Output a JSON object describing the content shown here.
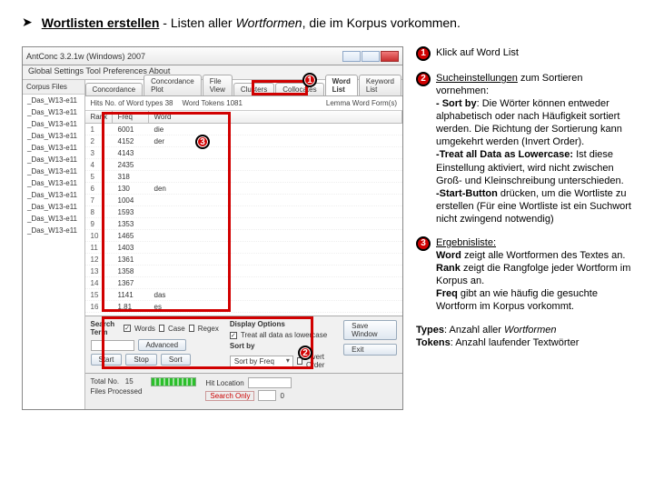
{
  "heading": {
    "bold": "Wortlisten erstellen",
    "rest_a": " - Listen aller ",
    "ital": "Wortformen",
    "rest_b": ", die im Korpus vorkommen."
  },
  "app": {
    "title": "AntConc 3.2.1w (Windows) 2007",
    "menu": "Global Settings  Tool Preferences  About",
    "sidebar_hd": "Corpus Files",
    "sidebar_items": [
      "_Das_W13-e11",
      "_Das_W13-e11",
      "_Das_W13-e11",
      "_Das_W13-e11",
      "_Das_W13-e11",
      "_Das_W13-e11",
      "_Das_W13-e11",
      "_Das_W13-e11",
      "_Das_W13-e11",
      "_Das_W13-e11",
      "_Das_W13-e11",
      "_Das_W13-e11"
    ],
    "tabs": [
      "Concordance",
      "Concordance Plot",
      "File View",
      "Clusters",
      "Collocates",
      "Word List",
      "Keyword List"
    ],
    "active_tab_index": 5,
    "sub_toolbar_a": "Hits No. of Word types 38",
    "sub_toolbar_b": "Word Tokens 1081",
    "sub_toolbar_c": "Lemma Word Form(s)",
    "table": {
      "head": [
        "Rank",
        "Freq",
        "Word"
      ],
      "rows": [
        [
          "1",
          "6001",
          "die"
        ],
        [
          "2",
          "4152",
          "der"
        ],
        [
          "3",
          "4143",
          ""
        ],
        [
          "4",
          "2435",
          ""
        ],
        [
          "5",
          "318",
          ""
        ],
        [
          "6",
          "130",
          "den"
        ],
        [
          "7",
          "1004",
          ""
        ],
        [
          "8",
          "1593",
          ""
        ],
        [
          "9",
          "1353",
          ""
        ],
        [
          "10",
          "1465",
          ""
        ],
        [
          "11",
          "1403",
          ""
        ],
        [
          "12",
          "1361",
          ""
        ],
        [
          "13",
          "1358",
          ""
        ],
        [
          "14",
          "1367",
          ""
        ],
        [
          "15",
          "1141",
          "das"
        ],
        [
          "16",
          "1.81",
          "es"
        ]
      ]
    },
    "bottom": {
      "search_term_label": "Search Term",
      "words": "Words",
      "case": "Case",
      "regex": "Regex",
      "display_label": "Display Options",
      "treat_lower": "Treat all data as lowercase",
      "hit_loc": "Hit Location",
      "sort_by_label": "Sort by",
      "sort_by_value": "Sort by Freq",
      "invert_order": "Invert Order",
      "start": "Start",
      "stop": "Stop",
      "sort": "Sort",
      "advanced": "Advanced",
      "save_window": "Save Window",
      "exit": "Exit",
      "total_no": "Total No.",
      "total_val": "15",
      "files_proc": "Files Processed",
      "search_only": "Search Only",
      "zero": "0"
    }
  },
  "callouts": {
    "n1": "1",
    "n2": "2",
    "n3": "3"
  },
  "right": {
    "item1": "Klick auf Word List",
    "item2_lead": "Sucheinstellungen",
    "item2_rest": " zum Sortieren vornehmen:",
    "item2_sortby_lead": "- Sort by",
    "item2_sortby_rest": ": Die Wörter können entweder alphabetisch oder nach Häufigkeit sortiert werden. Die Richtung der Sortierung kann umgekehrt werden (Invert Order).",
    "item2_treat_lead": "-Treat all Data as Lowercase:",
    "item2_treat_rest": " Ist diese Einstellung aktiviert, wird nicht zwischen Groß- und Kleinschreibung unterschieden.",
    "item2_start_lead": "-Start-Button",
    "item2_start_rest": " drücken, um die Wortliste zu erstellen (Für eine Wortliste ist ein Suchwort nicht zwingend notwendig)",
    "item3_lead": "Ergebnisliste:",
    "item3_word_lead": "Word",
    "item3_word_rest": " zeigt alle Wortformen des Textes an.",
    "item3_rank_lead": "Rank",
    "item3_rank_rest": " zeigt die Rangfolge jeder Wortform im Korpus an.",
    "item3_freq_lead": "Freq",
    "item3_freq_rest": " gibt an wie häufig die gesuchte Wortform im Korpus vorkommt.",
    "types_lead": "Types",
    "types_rest": ": Anzahl aller ",
    "types_ital": "Wortformen",
    "tokens_lead": "Tokens",
    "tokens_rest": ": Anzahl laufender Textwörter"
  }
}
